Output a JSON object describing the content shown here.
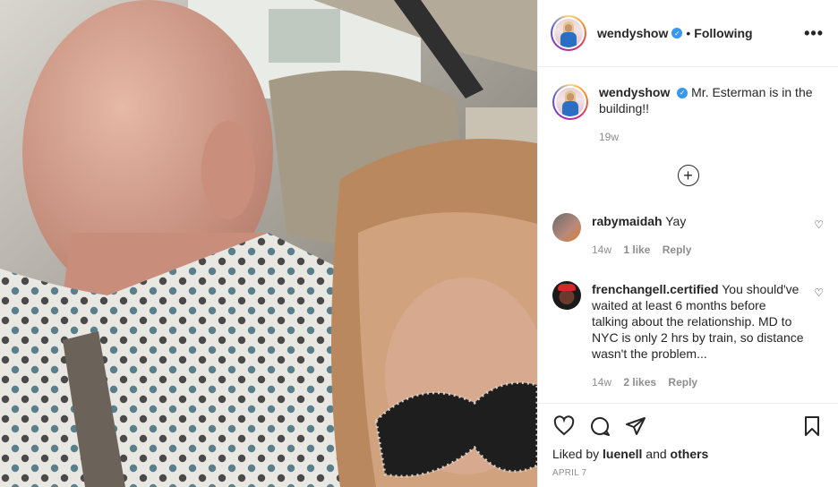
{
  "post": {
    "username": "wendyshow",
    "follow_status": "Following",
    "separator": "•",
    "more_label": "•••"
  },
  "caption": {
    "username": "wendyshow",
    "text": "Mr. Esterman is in the building!!",
    "time": "19w"
  },
  "load_more_label": "+",
  "comments": [
    {
      "username": "rabymaidah",
      "text": "Yay",
      "time": "14w",
      "likes": "1 like",
      "reply": "Reply"
    },
    {
      "username": "frenchangell.certified",
      "text": "You should've waited at least 6 months before talking about the relationship. MD to NYC is only 2 hrs by train, so distance wasn't the problem...",
      "time": "14w",
      "likes": "2 likes",
      "reply": "Reply"
    }
  ],
  "likes": {
    "prefix": "Liked by",
    "user": "luenell",
    "conj": "and",
    "others": "others"
  },
  "date": "APRIL 7",
  "icons": {
    "like": "heart-icon",
    "comment": "comment-icon",
    "share": "share-icon",
    "save": "bookmark-icon",
    "verified": "verified-badge-icon"
  },
  "colors": {
    "verified": "#3897f0",
    "text": "#262626",
    "muted": "#8e8e8e"
  }
}
